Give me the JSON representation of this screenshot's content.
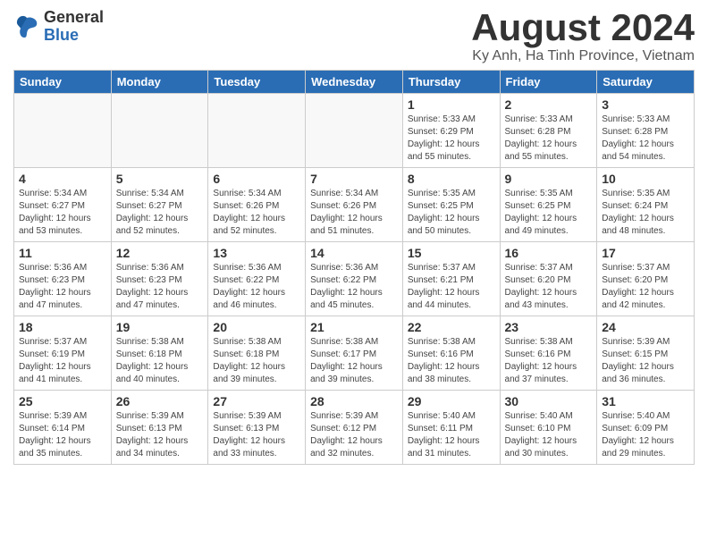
{
  "logo": {
    "general": "General",
    "blue": "Blue"
  },
  "header": {
    "title": "August 2024",
    "subtitle": "Ky Anh, Ha Tinh Province, Vietnam"
  },
  "days_of_week": [
    "Sunday",
    "Monday",
    "Tuesday",
    "Wednesday",
    "Thursday",
    "Friday",
    "Saturday"
  ],
  "weeks": [
    [
      {
        "day": "",
        "info": ""
      },
      {
        "day": "",
        "info": ""
      },
      {
        "day": "",
        "info": ""
      },
      {
        "day": "",
        "info": ""
      },
      {
        "day": "1",
        "info": "Sunrise: 5:33 AM\nSunset: 6:29 PM\nDaylight: 12 hours\nand 55 minutes."
      },
      {
        "day": "2",
        "info": "Sunrise: 5:33 AM\nSunset: 6:28 PM\nDaylight: 12 hours\nand 55 minutes."
      },
      {
        "day": "3",
        "info": "Sunrise: 5:33 AM\nSunset: 6:28 PM\nDaylight: 12 hours\nand 54 minutes."
      }
    ],
    [
      {
        "day": "4",
        "info": "Sunrise: 5:34 AM\nSunset: 6:27 PM\nDaylight: 12 hours\nand 53 minutes."
      },
      {
        "day": "5",
        "info": "Sunrise: 5:34 AM\nSunset: 6:27 PM\nDaylight: 12 hours\nand 52 minutes."
      },
      {
        "day": "6",
        "info": "Sunrise: 5:34 AM\nSunset: 6:26 PM\nDaylight: 12 hours\nand 52 minutes."
      },
      {
        "day": "7",
        "info": "Sunrise: 5:34 AM\nSunset: 6:26 PM\nDaylight: 12 hours\nand 51 minutes."
      },
      {
        "day": "8",
        "info": "Sunrise: 5:35 AM\nSunset: 6:25 PM\nDaylight: 12 hours\nand 50 minutes."
      },
      {
        "day": "9",
        "info": "Sunrise: 5:35 AM\nSunset: 6:25 PM\nDaylight: 12 hours\nand 49 minutes."
      },
      {
        "day": "10",
        "info": "Sunrise: 5:35 AM\nSunset: 6:24 PM\nDaylight: 12 hours\nand 48 minutes."
      }
    ],
    [
      {
        "day": "11",
        "info": "Sunrise: 5:36 AM\nSunset: 6:23 PM\nDaylight: 12 hours\nand 47 minutes."
      },
      {
        "day": "12",
        "info": "Sunrise: 5:36 AM\nSunset: 6:23 PM\nDaylight: 12 hours\nand 47 minutes."
      },
      {
        "day": "13",
        "info": "Sunrise: 5:36 AM\nSunset: 6:22 PM\nDaylight: 12 hours\nand 46 minutes."
      },
      {
        "day": "14",
        "info": "Sunrise: 5:36 AM\nSunset: 6:22 PM\nDaylight: 12 hours\nand 45 minutes."
      },
      {
        "day": "15",
        "info": "Sunrise: 5:37 AM\nSunset: 6:21 PM\nDaylight: 12 hours\nand 44 minutes."
      },
      {
        "day": "16",
        "info": "Sunrise: 5:37 AM\nSunset: 6:20 PM\nDaylight: 12 hours\nand 43 minutes."
      },
      {
        "day": "17",
        "info": "Sunrise: 5:37 AM\nSunset: 6:20 PM\nDaylight: 12 hours\nand 42 minutes."
      }
    ],
    [
      {
        "day": "18",
        "info": "Sunrise: 5:37 AM\nSunset: 6:19 PM\nDaylight: 12 hours\nand 41 minutes."
      },
      {
        "day": "19",
        "info": "Sunrise: 5:38 AM\nSunset: 6:18 PM\nDaylight: 12 hours\nand 40 minutes."
      },
      {
        "day": "20",
        "info": "Sunrise: 5:38 AM\nSunset: 6:18 PM\nDaylight: 12 hours\nand 39 minutes."
      },
      {
        "day": "21",
        "info": "Sunrise: 5:38 AM\nSunset: 6:17 PM\nDaylight: 12 hours\nand 39 minutes."
      },
      {
        "day": "22",
        "info": "Sunrise: 5:38 AM\nSunset: 6:16 PM\nDaylight: 12 hours\nand 38 minutes."
      },
      {
        "day": "23",
        "info": "Sunrise: 5:38 AM\nSunset: 6:16 PM\nDaylight: 12 hours\nand 37 minutes."
      },
      {
        "day": "24",
        "info": "Sunrise: 5:39 AM\nSunset: 6:15 PM\nDaylight: 12 hours\nand 36 minutes."
      }
    ],
    [
      {
        "day": "25",
        "info": "Sunrise: 5:39 AM\nSunset: 6:14 PM\nDaylight: 12 hours\nand 35 minutes."
      },
      {
        "day": "26",
        "info": "Sunrise: 5:39 AM\nSunset: 6:13 PM\nDaylight: 12 hours\nand 34 minutes."
      },
      {
        "day": "27",
        "info": "Sunrise: 5:39 AM\nSunset: 6:13 PM\nDaylight: 12 hours\nand 33 minutes."
      },
      {
        "day": "28",
        "info": "Sunrise: 5:39 AM\nSunset: 6:12 PM\nDaylight: 12 hours\nand 32 minutes."
      },
      {
        "day": "29",
        "info": "Sunrise: 5:40 AM\nSunset: 6:11 PM\nDaylight: 12 hours\nand 31 minutes."
      },
      {
        "day": "30",
        "info": "Sunrise: 5:40 AM\nSunset: 6:10 PM\nDaylight: 12 hours\nand 30 minutes."
      },
      {
        "day": "31",
        "info": "Sunrise: 5:40 AM\nSunset: 6:09 PM\nDaylight: 12 hours\nand 29 minutes."
      }
    ]
  ]
}
